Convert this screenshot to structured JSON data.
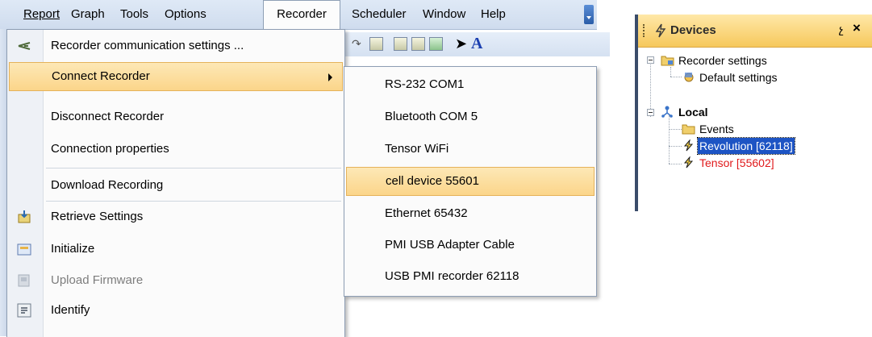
{
  "menubar": {
    "items": [
      {
        "label": "Report"
      },
      {
        "label": "Graph"
      },
      {
        "label": "Tools"
      },
      {
        "label": "Options"
      },
      {
        "label": "Recorder"
      },
      {
        "label": "Scheduler"
      },
      {
        "label": "Window"
      },
      {
        "label": "Help"
      }
    ],
    "active": "Recorder"
  },
  "recorder_menu": {
    "items": [
      {
        "label": "Recorder communication settings ...",
        "icon": "antenna-icon"
      },
      {
        "label": "Connect Recorder",
        "highlighted": true,
        "has_submenu": true
      },
      {
        "label": "Disconnect Recorder"
      },
      {
        "label": "Connection properties"
      },
      {
        "label": "Download Recording"
      },
      {
        "label": "Retrieve Settings",
        "icon": "retrieve-icon"
      },
      {
        "label": "Initialize",
        "icon": "initialize-icon"
      },
      {
        "label": "Upload Firmware",
        "icon": "upload-firmware-icon",
        "disabled": true
      },
      {
        "label": "Identify",
        "icon": "identify-icon"
      }
    ]
  },
  "connect_submenu": {
    "items": [
      {
        "label": "RS-232 COM1"
      },
      {
        "label": "Bluetooth COM 5"
      },
      {
        "label": "Tensor WiFi"
      },
      {
        "label": "cell device 55601",
        "highlighted": true
      },
      {
        "label": "Ethernet 65432"
      },
      {
        "label": "PMI USB Adapter Cable"
      },
      {
        "label": "USB PMI recorder 62118"
      }
    ]
  },
  "devices_panel": {
    "title": "Devices",
    "pin_glyph": "չ",
    "close_glyph": "×",
    "tree": [
      {
        "label": "Recorder settings",
        "icon": "folder-settings-icon"
      },
      {
        "label": "Default settings",
        "icon": "settings-icon"
      },
      {
        "label": "Local",
        "icon": "network-icon"
      },
      {
        "label": "Events",
        "icon": "folder-icon"
      },
      {
        "label": "Revolution [62118]",
        "icon": "recorder-bolt-icon",
        "selected": true
      },
      {
        "label": "Tensor [55602]",
        "icon": "recorder-bolt-icon",
        "color": "#e0191b"
      }
    ]
  },
  "colors": {
    "menu_highlight": "#fbd58a",
    "selection": "#1d54c4",
    "header": "#f6c85c",
    "error_text": "#e0191b"
  }
}
